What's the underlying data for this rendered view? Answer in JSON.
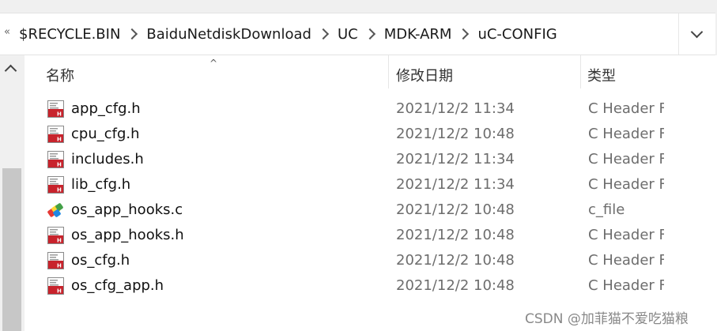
{
  "address_bar": {
    "overflow_glyph": "«",
    "crumbs": [
      "$RECYCLE.BIN",
      "BaiduNetdiskDownload",
      "UC",
      "MDK-ARM",
      "uC-CONFIG"
    ]
  },
  "columns": {
    "name": "名称",
    "date": "修改日期",
    "type": "类型"
  },
  "files": [
    {
      "name": "app_cfg.h",
      "date": "2021/12/2 11:34",
      "type": "C Header F",
      "icon": "h-file-icon"
    },
    {
      "name": "cpu_cfg.h",
      "date": "2021/12/2 10:48",
      "type": "C Header F",
      "icon": "h-file-icon"
    },
    {
      "name": "includes.h",
      "date": "2021/12/2 11:34",
      "type": "C Header F",
      "icon": "h-file-icon"
    },
    {
      "name": "lib_cfg.h",
      "date": "2021/12/2 11:34",
      "type": "C Header F",
      "icon": "h-file-icon"
    },
    {
      "name": "os_app_hooks.c",
      "date": "2021/12/2 10:48",
      "type": "c_file",
      "icon": "c-file-icon"
    },
    {
      "name": "os_app_hooks.h",
      "date": "2021/12/2 10:48",
      "type": "C Header F",
      "icon": "h-file-icon"
    },
    {
      "name": "os_cfg.h",
      "date": "2021/12/2 10:48",
      "type": "C Header F",
      "icon": "h-file-icon"
    },
    {
      "name": "os_cfg_app.h",
      "date": "2021/12/2 10:48",
      "type": "C Header F",
      "icon": "h-file-icon"
    }
  ],
  "watermark": "CSDN @加菲猫不爱吃猫粮"
}
